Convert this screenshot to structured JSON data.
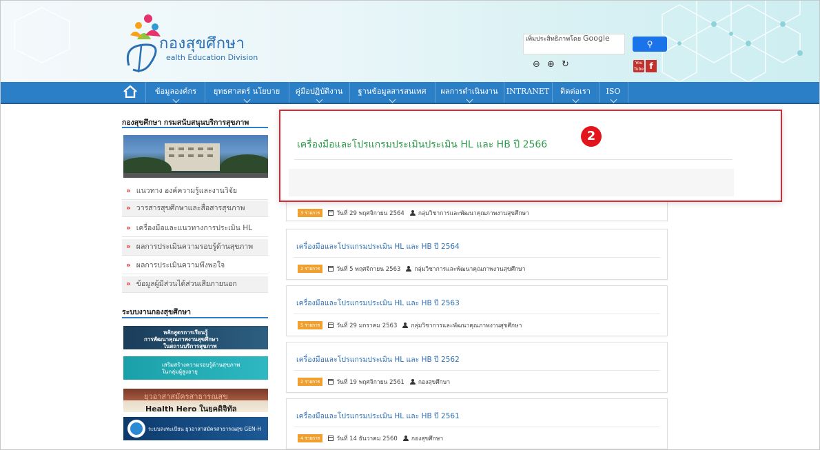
{
  "header": {
    "site_title": "กองสุขศึกษา",
    "site_subtitle": "ealth Education Division",
    "search_label": "เพิ่มประสิทธิภาพโดย",
    "search_brand": "Google",
    "search_button_icon": "search-icon",
    "zoom_controls": [
      "zoom-out-icon",
      "zoom-in-icon",
      "reset-icon"
    ],
    "social": {
      "youtube_label": "You Tube",
      "facebook_label": "f"
    }
  },
  "nav": {
    "items": [
      {
        "label": "ข้อมูลองค์กร"
      },
      {
        "label": "ยุทธศาสตร์ นโยบาย"
      },
      {
        "label": "คู่มือปฏิบัติงาน"
      },
      {
        "label": "ฐานข้อมูลสารสนเทศ"
      },
      {
        "label": "ผลการดำเนินงาน"
      },
      {
        "label": "INTRANET"
      },
      {
        "label": "ติดต่อเรา"
      },
      {
        "label": "ISO"
      }
    ]
  },
  "sidebar": {
    "title": "กองสุขศึกษา กรมสนับสนุนบริการสุขภาพ",
    "menu": [
      {
        "label": "แนวทาง องค์ความรู้และงานวิจัย"
      },
      {
        "label": "วารสารสุขศึกษาและสื่อสารสุขภาพ"
      },
      {
        "label": "เครื่องมือและแนวทางการประเมิน HL"
      },
      {
        "label": "ผลการประเมินความรอบรู้ด้านสุขภาพ"
      },
      {
        "label": "ผลการประเมินความพึงพอใจ"
      },
      {
        "label": "ข้อมูลผู้มีส่วนได้ส่วนเสียภายนอก"
      }
    ],
    "systems_title": "ระบบงานกองสุขศึกษา",
    "banners": [
      {
        "line1": "หลักสูตรการเรียนรู้",
        "line2": "การพัฒนาคุณภาพงานสุขศึกษา",
        "line3": "ในสถานบริการสุขภาพ"
      },
      {
        "line1": "เสริมสร้างความรอบรู้ด้านสุขภาพ",
        "line2": "ในกลุ่มผู้สูงอายุ"
      },
      {
        "line1": "ยุวอาสาสมัครสาธารณสุข",
        "line2": "Health Hero ในยุคดิจิทัล"
      },
      {
        "line1": "ระบบลงทะเบียน ยุวอาสาสมัครสาธารณสุข GEN-H"
      }
    ]
  },
  "popup": {
    "title": "เครื่องมือและโปรแกรมประเมินประเมิน HL และ HB ปี 2566",
    "step_number": "2"
  },
  "items": [
    {
      "badge": "3 รายการ",
      "date": "วันที่ 29 พฤศจิกายน 2564",
      "author": "กลุ่มวิชาการและพัฒนาคุณภาพงานสุขศึกษา"
    },
    {
      "title": "เครื่องมือและโปรแกรมประเมิน HL และ HB ปี 2564",
      "badge": "2 รายการ",
      "date": "วันที่ 5 พฤศจิกายน 2563",
      "author": "กลุ่มวิชาการและพัฒนาคุณภาพงานสุขศึกษา"
    },
    {
      "title": "เครื่องมือและโปรแกรมประเมิน HL และ HB ปี 2563",
      "badge": "5 รายการ",
      "date": "วันที่ 29 มกราคม 2563",
      "author": "กลุ่มวิชาการและพัฒนาคุณภาพงานสุขศึกษา"
    },
    {
      "title": "เครื่องมือและโปรแกรมประเมิน HL และ HB ปี 2562",
      "badge": "2 รายการ",
      "date": "วันที่ 19 พฤศจิกายน 2561",
      "author": "กองสุขศึกษา"
    },
    {
      "title": "เครื่องมือและโปรแกรมประเมิน HL และ HB ปี 2561",
      "badge": "4 รายการ",
      "date": "วันที่ 14 ธันวาคม 2560",
      "author": "กองสุขศึกษา"
    }
  ]
}
